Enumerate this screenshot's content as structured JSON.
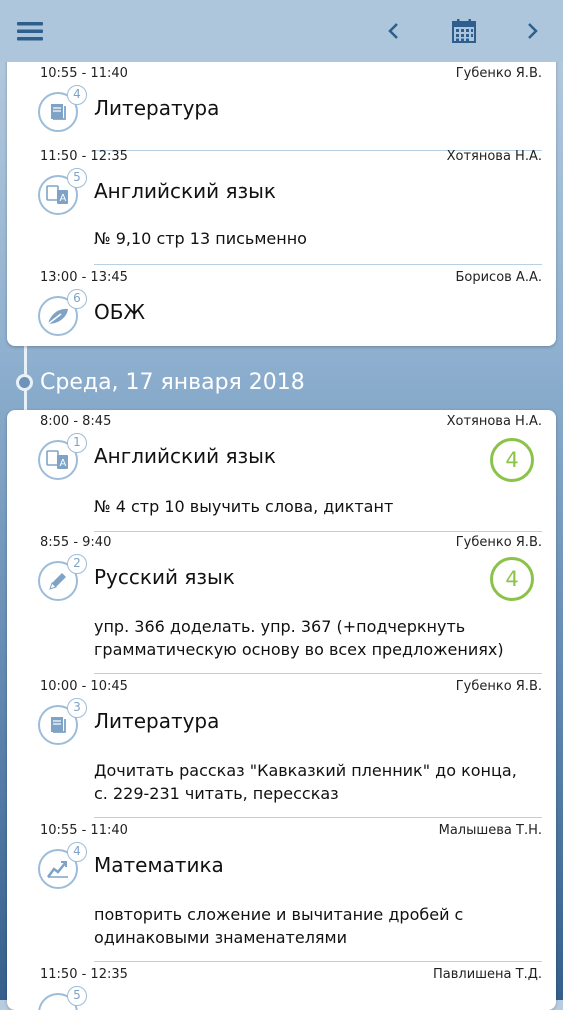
{
  "colors": {
    "accent": "#2d5f8e",
    "grade": "#8bc34a",
    "icon_border": "#9cbcd9"
  },
  "topbar": {
    "menu_icon": "hamburger-icon",
    "prev_icon": "chevron-left-icon",
    "calendar_icon": "calendar-icon",
    "next_icon": "chevron-right-icon"
  },
  "day1": {
    "lessons": [
      {
        "time": "10:55 - 11:40",
        "teacher": "Губенко Я.В.",
        "number": "4",
        "subject": "Литература",
        "icon": "book-icon",
        "homework": ""
      },
      {
        "time": "11:50 - 12:35",
        "teacher": "Хотянова Н.А.",
        "number": "5",
        "subject": "Английский язык",
        "icon": "translate-icon",
        "homework": "№ 9,10 стр 13 письменно"
      },
      {
        "time": "13:00 - 13:45",
        "teacher": "Борисов А.А.",
        "number": "6",
        "subject": "ОБЖ",
        "icon": "leaf-icon",
        "homework": ""
      }
    ]
  },
  "day2": {
    "header": "Среда, 17 января 2018",
    "lessons": [
      {
        "time": "8:00 - 8:45",
        "teacher": "Хотянова Н.А.",
        "number": "1",
        "subject": "Английский язык",
        "icon": "translate-icon",
        "homework": "№ 4 стр 10 выучить слова, диктант",
        "grade": "4"
      },
      {
        "time": "8:55 - 9:40",
        "teacher": "Губенко Я.В.",
        "number": "2",
        "subject": "Русский язык",
        "icon": "pencil-icon",
        "homework_line1": "упр. 366 доделать. упр. 367 (+подчеркнуть",
        "homework_line2": "грамматическую основу во всех предложениях)",
        "grade": "4"
      },
      {
        "time": "10:00 - 10:45",
        "teacher": "Губенко Я.В.",
        "number": "3",
        "subject": "Литература",
        "icon": "book-icon",
        "homework_line1": "Дочитать рассказ \"Кавказкий пленник\" до конца,",
        "homework_line2": "с. 229-231 читать, перессказ"
      },
      {
        "time": "10:55 - 11:40",
        "teacher": "Малышева Т.Н.",
        "number": "4",
        "subject": "Математика",
        "icon": "chart-icon",
        "homework_line1": "повторить сложение и вычитание дробей с",
        "homework_line2": "одинаковыми знаменателями"
      },
      {
        "time": "11:50 - 12:35",
        "teacher": "Павлишена Т.Д.",
        "number": "5"
      }
    ]
  }
}
